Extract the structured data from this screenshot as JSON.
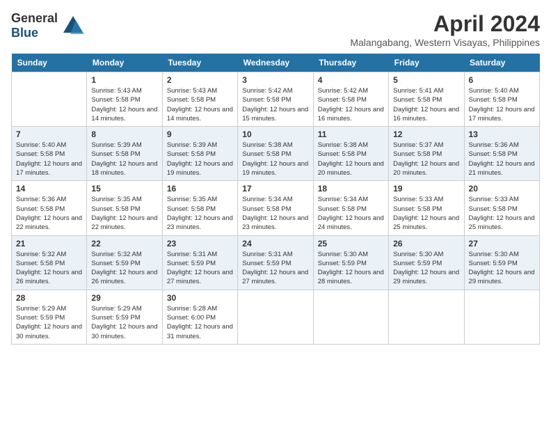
{
  "header": {
    "logo_general": "General",
    "logo_blue": "Blue",
    "month_year": "April 2024",
    "location": "Malangabang, Western Visayas, Philippines"
  },
  "weekdays": [
    "Sunday",
    "Monday",
    "Tuesday",
    "Wednesday",
    "Thursday",
    "Friday",
    "Saturday"
  ],
  "weeks": [
    [
      {
        "day": "",
        "sunrise": "",
        "sunset": "",
        "daylight": ""
      },
      {
        "day": "1",
        "sunrise": "Sunrise: 5:43 AM",
        "sunset": "Sunset: 5:58 PM",
        "daylight": "Daylight: 12 hours and 14 minutes."
      },
      {
        "day": "2",
        "sunrise": "Sunrise: 5:43 AM",
        "sunset": "Sunset: 5:58 PM",
        "daylight": "Daylight: 12 hours and 14 minutes."
      },
      {
        "day": "3",
        "sunrise": "Sunrise: 5:42 AM",
        "sunset": "Sunset: 5:58 PM",
        "daylight": "Daylight: 12 hours and 15 minutes."
      },
      {
        "day": "4",
        "sunrise": "Sunrise: 5:42 AM",
        "sunset": "Sunset: 5:58 PM",
        "daylight": "Daylight: 12 hours and 16 minutes."
      },
      {
        "day": "5",
        "sunrise": "Sunrise: 5:41 AM",
        "sunset": "Sunset: 5:58 PM",
        "daylight": "Daylight: 12 hours and 16 minutes."
      },
      {
        "day": "6",
        "sunrise": "Sunrise: 5:40 AM",
        "sunset": "Sunset: 5:58 PM",
        "daylight": "Daylight: 12 hours and 17 minutes."
      }
    ],
    [
      {
        "day": "7",
        "sunrise": "Sunrise: 5:40 AM",
        "sunset": "Sunset: 5:58 PM",
        "daylight": "Daylight: 12 hours and 17 minutes."
      },
      {
        "day": "8",
        "sunrise": "Sunrise: 5:39 AM",
        "sunset": "Sunset: 5:58 PM",
        "daylight": "Daylight: 12 hours and 18 minutes."
      },
      {
        "day": "9",
        "sunrise": "Sunrise: 5:39 AM",
        "sunset": "Sunset: 5:58 PM",
        "daylight": "Daylight: 12 hours and 19 minutes."
      },
      {
        "day": "10",
        "sunrise": "Sunrise: 5:38 AM",
        "sunset": "Sunset: 5:58 PM",
        "daylight": "Daylight: 12 hours and 19 minutes."
      },
      {
        "day": "11",
        "sunrise": "Sunrise: 5:38 AM",
        "sunset": "Sunset: 5:58 PM",
        "daylight": "Daylight: 12 hours and 20 minutes."
      },
      {
        "day": "12",
        "sunrise": "Sunrise: 5:37 AM",
        "sunset": "Sunset: 5:58 PM",
        "daylight": "Daylight: 12 hours and 20 minutes."
      },
      {
        "day": "13",
        "sunrise": "Sunrise: 5:36 AM",
        "sunset": "Sunset: 5:58 PM",
        "daylight": "Daylight: 12 hours and 21 minutes."
      }
    ],
    [
      {
        "day": "14",
        "sunrise": "Sunrise: 5:36 AM",
        "sunset": "Sunset: 5:58 PM",
        "daylight": "Daylight: 12 hours and 22 minutes."
      },
      {
        "day": "15",
        "sunrise": "Sunrise: 5:35 AM",
        "sunset": "Sunset: 5:58 PM",
        "daylight": "Daylight: 12 hours and 22 minutes."
      },
      {
        "day": "16",
        "sunrise": "Sunrise: 5:35 AM",
        "sunset": "Sunset: 5:58 PM",
        "daylight": "Daylight: 12 hours and 23 minutes."
      },
      {
        "day": "17",
        "sunrise": "Sunrise: 5:34 AM",
        "sunset": "Sunset: 5:58 PM",
        "daylight": "Daylight: 12 hours and 23 minutes."
      },
      {
        "day": "18",
        "sunrise": "Sunrise: 5:34 AM",
        "sunset": "Sunset: 5:58 PM",
        "daylight": "Daylight: 12 hours and 24 minutes."
      },
      {
        "day": "19",
        "sunrise": "Sunrise: 5:33 AM",
        "sunset": "Sunset: 5:58 PM",
        "daylight": "Daylight: 12 hours and 25 minutes."
      },
      {
        "day": "20",
        "sunrise": "Sunrise: 5:33 AM",
        "sunset": "Sunset: 5:58 PM",
        "daylight": "Daylight: 12 hours and 25 minutes."
      }
    ],
    [
      {
        "day": "21",
        "sunrise": "Sunrise: 5:32 AM",
        "sunset": "Sunset: 5:58 PM",
        "daylight": "Daylight: 12 hours and 26 minutes."
      },
      {
        "day": "22",
        "sunrise": "Sunrise: 5:32 AM",
        "sunset": "Sunset: 5:59 PM",
        "daylight": "Daylight: 12 hours and 26 minutes."
      },
      {
        "day": "23",
        "sunrise": "Sunrise: 5:31 AM",
        "sunset": "Sunset: 5:59 PM",
        "daylight": "Daylight: 12 hours and 27 minutes."
      },
      {
        "day": "24",
        "sunrise": "Sunrise: 5:31 AM",
        "sunset": "Sunset: 5:59 PM",
        "daylight": "Daylight: 12 hours and 27 minutes."
      },
      {
        "day": "25",
        "sunrise": "Sunrise: 5:30 AM",
        "sunset": "Sunset: 5:59 PM",
        "daylight": "Daylight: 12 hours and 28 minutes."
      },
      {
        "day": "26",
        "sunrise": "Sunrise: 5:30 AM",
        "sunset": "Sunset: 5:59 PM",
        "daylight": "Daylight: 12 hours and 29 minutes."
      },
      {
        "day": "27",
        "sunrise": "Sunrise: 5:30 AM",
        "sunset": "Sunset: 5:59 PM",
        "daylight": "Daylight: 12 hours and 29 minutes."
      }
    ],
    [
      {
        "day": "28",
        "sunrise": "Sunrise: 5:29 AM",
        "sunset": "Sunset: 5:59 PM",
        "daylight": "Daylight: 12 hours and 30 minutes."
      },
      {
        "day": "29",
        "sunrise": "Sunrise: 5:29 AM",
        "sunset": "Sunset: 5:59 PM",
        "daylight": "Daylight: 12 hours and 30 minutes."
      },
      {
        "day": "30",
        "sunrise": "Sunrise: 5:28 AM",
        "sunset": "Sunset: 6:00 PM",
        "daylight": "Daylight: 12 hours and 31 minutes."
      },
      {
        "day": "",
        "sunrise": "",
        "sunset": "",
        "daylight": ""
      },
      {
        "day": "",
        "sunrise": "",
        "sunset": "",
        "daylight": ""
      },
      {
        "day": "",
        "sunrise": "",
        "sunset": "",
        "daylight": ""
      },
      {
        "day": "",
        "sunrise": "",
        "sunset": "",
        "daylight": ""
      }
    ]
  ]
}
